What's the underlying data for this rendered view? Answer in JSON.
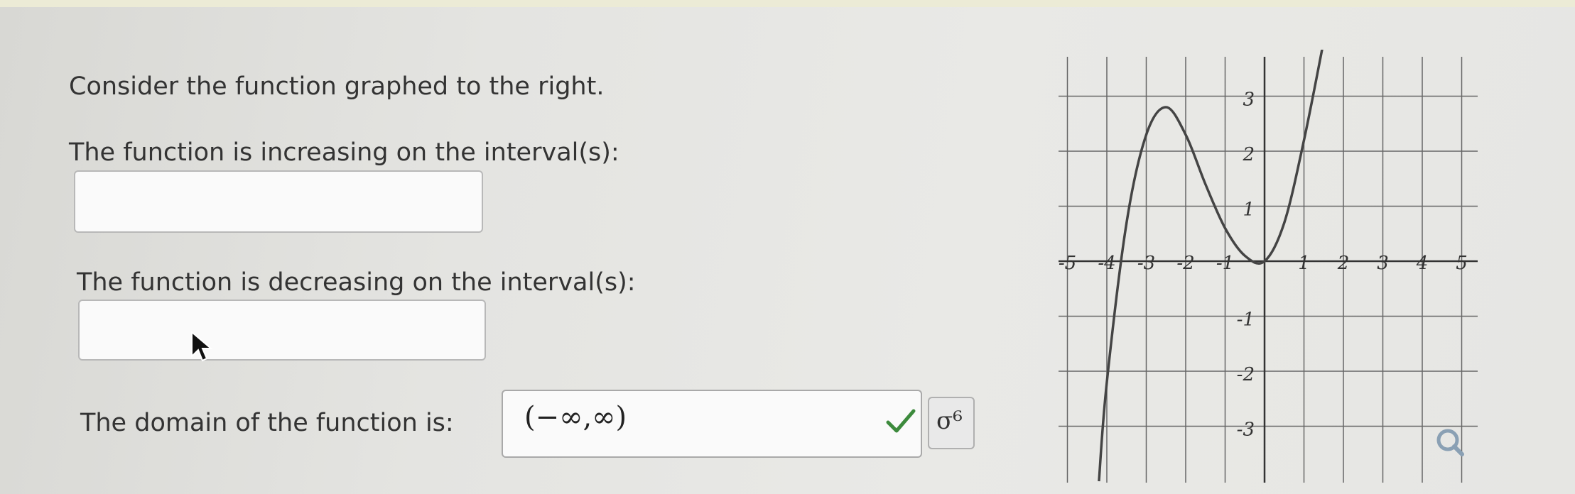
{
  "question": {
    "intro": "Consider the function graphed to the right.",
    "increasing_label": "The function is increasing on the interval(s):",
    "increasing_value": "",
    "decreasing_label": "The function is decreasing on the interval(s):",
    "decreasing_value": "",
    "domain_label": "The domain of the function is:",
    "domain_value": "(−∞,∞)",
    "domain_status": "correct"
  },
  "toolbar": {
    "key_button_label": "σ⁶"
  },
  "chart_data": {
    "type": "line",
    "title": "",
    "xlabel": "",
    "ylabel": "",
    "xlim": [
      -5,
      5
    ],
    "ylim": [
      -3.8,
      3.8
    ],
    "grid": true,
    "x_tick_labels": [
      "-5",
      "-4",
      "-3",
      "-2",
      "-1",
      "1",
      "2",
      "3",
      "4",
      "5"
    ],
    "y_tick_labels": [
      "3",
      "2",
      "1",
      "-1",
      "-2",
      "-3"
    ],
    "series": [
      {
        "x": [
          -4.2,
          -4.0,
          -3.5,
          -3.0,
          -2.5,
          -2.0,
          -1.5,
          -1.0,
          -0.5,
          0.0,
          0.5,
          1.0,
          1.5
        ],
        "y": [
          -4.0,
          -2.2,
          0.7,
          2.3,
          2.8,
          2.3,
          1.4,
          0.6,
          0.1,
          0.0,
          0.7,
          2.2,
          4.0
        ]
      }
    ]
  }
}
